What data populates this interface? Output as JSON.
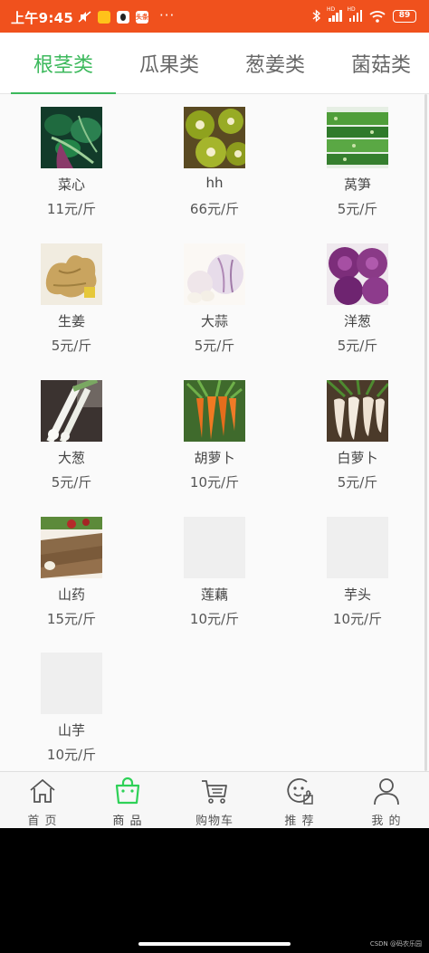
{
  "status_bar": {
    "time": "上午9:45",
    "app_badge": "头条",
    "more": "···",
    "battery": "89",
    "signal_tag": "HD"
  },
  "tabs": [
    {
      "label": "根茎类",
      "active": true
    },
    {
      "label": "瓜果类",
      "active": false
    },
    {
      "label": "葱姜类",
      "active": false
    },
    {
      "label": "菌菇类",
      "active": false
    }
  ],
  "colors": {
    "accent": "#3cb95c",
    "status_bar": "#f0511d"
  },
  "products": [
    {
      "name": "菜心",
      "price": "11元/斤",
      "image": "choy-sum"
    },
    {
      "name": "hh",
      "price": "66元/斤",
      "image": "kiwi"
    },
    {
      "name": "莴笋",
      "price": "5元/斤",
      "image": "lettuce-stem"
    },
    {
      "name": "生姜",
      "price": "5元/斤",
      "image": "ginger"
    },
    {
      "name": "大蒜",
      "price": "5元/斤",
      "image": "garlic"
    },
    {
      "name": "洋葱",
      "price": "5元/斤",
      "image": "onion"
    },
    {
      "name": "大葱",
      "price": "5元/斤",
      "image": "scallion"
    },
    {
      "name": "胡萝卜",
      "price": "10元/斤",
      "image": "carrot"
    },
    {
      "name": "白萝卜",
      "price": "5元/斤",
      "image": "white-radish"
    },
    {
      "name": "山药",
      "price": "15元/斤",
      "image": "yam"
    },
    {
      "name": "莲藕",
      "price": "10元/斤",
      "image": "placeholder"
    },
    {
      "name": "芋头",
      "price": "10元/斤",
      "image": "placeholder"
    },
    {
      "name": "山芋",
      "price": "10元/斤",
      "image": "placeholder"
    }
  ],
  "bottom_nav": [
    {
      "label": "首 页",
      "icon": "home-icon",
      "active": false
    },
    {
      "label": "商 品",
      "icon": "shopping-bag-icon",
      "active": true
    },
    {
      "label": "购物车",
      "icon": "cart-icon",
      "active": false
    },
    {
      "label": "推 荐",
      "icon": "recommend-icon",
      "active": false
    },
    {
      "label": "我 的",
      "icon": "user-icon",
      "active": false
    }
  ],
  "watermark": "CSDN @码农乐园"
}
